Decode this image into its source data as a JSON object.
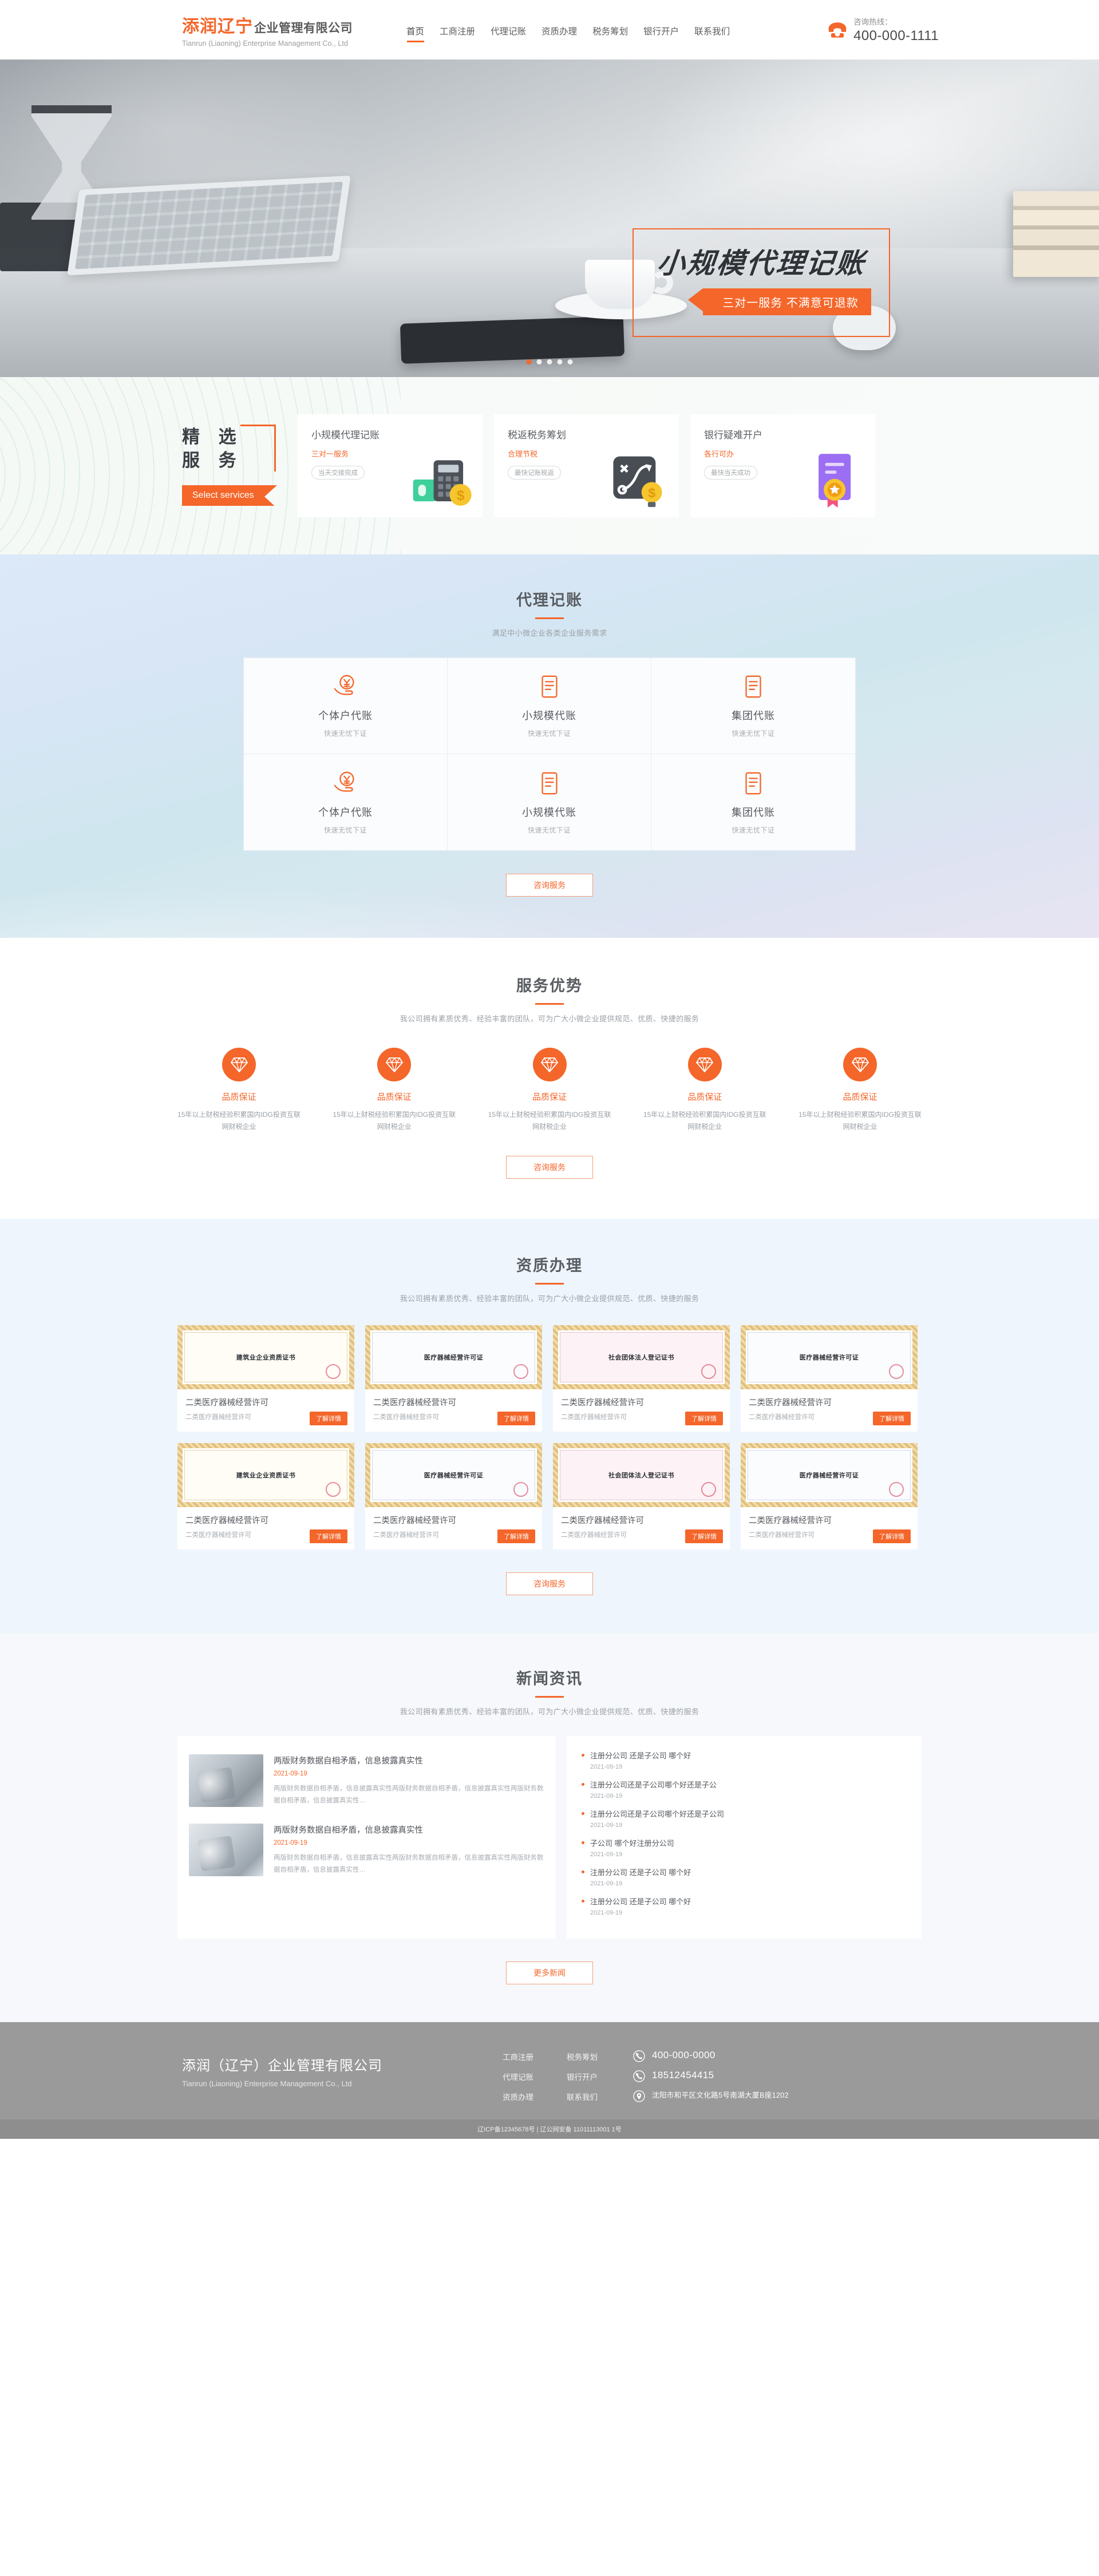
{
  "header": {
    "logo_cn_orange": "添润辽宁",
    "logo_cn_gray": "企业管理有限公司",
    "logo_en": "Tianrun (Liaoning) Enterprise Management Co., Ltd",
    "nav": [
      {
        "label": "首页",
        "active": true
      },
      {
        "label": "工商注册",
        "active": false
      },
      {
        "label": "代理记账",
        "active": false
      },
      {
        "label": "资质办理",
        "active": false
      },
      {
        "label": "税务筹划",
        "active": false
      },
      {
        "label": "银行开户",
        "active": false
      },
      {
        "label": "联系我们",
        "active": false
      }
    ],
    "tel_label": "咨询热线：",
    "tel_number": "400-000-1111"
  },
  "banner": {
    "title": "小规模代理记账",
    "ribbon": "三对一服务 不满意可退款",
    "dots": 5,
    "active_dot": 0
  },
  "select_services": {
    "title_line1": "精 选",
    "title_line2": "服 务",
    "button": "Select services",
    "cards": [
      {
        "title": "小规模代理记账",
        "sub": "三对一服务",
        "tag": "当天交接完成",
        "icon": "calculator-money-icon"
      },
      {
        "title": "税返税务筹划",
        "sub": "合理节税",
        "tag": "最快记账税返",
        "icon": "strategy-bulb-icon"
      },
      {
        "title": "银行疑难开户",
        "sub": "各行可办",
        "tag": "最快当天成功",
        "icon": "certificate-medal-icon"
      }
    ]
  },
  "bookkeeping": {
    "title": "代理记账",
    "subtitle": "满足中小微企业各类企业服务需求",
    "cta": "咨询服务",
    "cells": [
      {
        "title": "个体户代账",
        "sub": "快速无忧下证",
        "icon": "hand-yuan-icon"
      },
      {
        "title": "小规模代账",
        "sub": "快速无忧下证",
        "icon": "document-list-icon"
      },
      {
        "title": "集团代账",
        "sub": "快速无忧下证",
        "icon": "document-list-icon"
      },
      {
        "title": "个体户代账",
        "sub": "快速无忧下证",
        "icon": "hand-yuan-icon"
      },
      {
        "title": "小规模代账",
        "sub": "快速无忧下证",
        "icon": "document-list-icon"
      },
      {
        "title": "集团代账",
        "sub": "快速无忧下证",
        "icon": "document-list-icon"
      }
    ]
  },
  "advantage": {
    "title": "服务优势",
    "subtitle": "我公司拥有素质优秀、经验丰富的团队，可为广大小微企业提供规范、优质、快捷的服务",
    "cta": "咨询服务",
    "items": [
      {
        "title": "品质保证",
        "desc": "15年以上财税经验积累国内IDG投资互联网财税企业",
        "icon": "diamond-icon"
      },
      {
        "title": "品质保证",
        "desc": "15年以上财税经验积累国内IDG投资互联网财税企业",
        "icon": "diamond-icon"
      },
      {
        "title": "品质保证",
        "desc": "15年以上财税经验积累国内IDG投资互联网财税企业",
        "icon": "diamond-icon"
      },
      {
        "title": "品质保证",
        "desc": "15年以上财税经验积累国内IDG投资互联网财税企业",
        "icon": "diamond-icon"
      },
      {
        "title": "品质保证",
        "desc": "15年以上财税经验积累国内IDG投资互联网财税企业",
        "icon": "diamond-icon"
      }
    ]
  },
  "qualification": {
    "title": "资质办理",
    "subtitle": "我公司拥有素质优秀、经验丰富的团队，可为广大小微企业提供规范、优质、快捷的服务",
    "cta": "咨询服务",
    "button_label": "了解详情",
    "cards": [
      {
        "title": "二类医疗器械经营许可",
        "sub": "二类医疗器械经营许可",
        "cert_text": "建筑业企业资质证书",
        "style": "gold"
      },
      {
        "title": "二类医疗器械经营许可",
        "sub": "二类医疗器械经营许可",
        "cert_text": "医疗器械经营许可证",
        "style": "blue"
      },
      {
        "title": "二类医疗器械经营许可",
        "sub": "二类医疗器械经营许可",
        "cert_text": "社会团体法人登记证书",
        "style": "pink"
      },
      {
        "title": "二类医疗器械经营许可",
        "sub": "二类医疗器械经营许可",
        "cert_text": "医疗器械经营许可证",
        "style": "blue"
      },
      {
        "title": "二类医疗器械经营许可",
        "sub": "二类医疗器械经营许可",
        "cert_text": "建筑业企业资质证书",
        "style": "gold"
      },
      {
        "title": "二类医疗器械经营许可",
        "sub": "二类医疗器械经营许可",
        "cert_text": "医疗器械经营许可证",
        "style": "blue"
      },
      {
        "title": "二类医疗器械经营许可",
        "sub": "二类医疗器械经营许可",
        "cert_text": "社会团体法人登记证书",
        "style": "pink"
      },
      {
        "title": "二类医疗器械经营许可",
        "sub": "二类医疗器械经营许可",
        "cert_text": "医疗器械经营许可证",
        "style": "blue"
      }
    ]
  },
  "news": {
    "title": "新闻资讯",
    "subtitle": "我公司拥有素质优秀、经验丰富的团队，可为广大小微企业提供规范、优质、快捷的服务",
    "cta": "更多新闻",
    "featured": [
      {
        "title": "两版财务数据自相矛盾，信息披露真实性",
        "date": "2021-09-19",
        "excerpt": "两版财务数据自相矛盾，信息披露真实性两版财务数据自相矛盾，信息披露真实性两版财务数据自相矛盾，信息披露真实性…"
      },
      {
        "title": "两版财务数据自相矛盾，信息披露真实性",
        "date": "2021-09-19",
        "excerpt": "两版财务数据自相矛盾，信息披露真实性两版财务数据自相矛盾，信息披露真实性两版财务数据自相矛盾，信息披露真实性…"
      }
    ],
    "list": [
      {
        "title": "注册分公司 还是子公司 哪个好",
        "date": "2021-09-19"
      },
      {
        "title": "注册分公司还是子公司哪个好还是子公",
        "date": "2021-09-19"
      },
      {
        "title": "注册分公司还是子公司哪个好还是子公司",
        "date": "2021-09-19"
      },
      {
        "title": "子公司 哪个好注册分公司",
        "date": "2021-09-19"
      },
      {
        "title": "注册分公司 还是子公司 哪个好",
        "date": "2021-09-19"
      },
      {
        "title": "注册分公司 还是子公司 哪个好",
        "date": "2021-09-19"
      }
    ]
  },
  "footer": {
    "brand_cn": "添润（辽宁）企业管理有限公司",
    "brand_en": "Tianrun (Liaoning) Enterprise Management Co., Ltd",
    "links_col1": [
      "工商注册",
      "代理记账",
      "资质办理"
    ],
    "links_col2": [
      "税务筹划",
      "银行开户",
      "联系我们"
    ],
    "phone1": "400-000-0000",
    "phone2": "18512454415",
    "address": "沈阳市和平区文化路5号南湖大厦B座1202",
    "copyright": "辽ICP备12345678号 | 辽公网安备 11011113001 1号"
  },
  "colors": {
    "accent": "#f4662a",
    "text_dark": "#4a4a4a",
    "text_muted": "#9aa0a6",
    "footer_bg": "#9a9a9a"
  }
}
